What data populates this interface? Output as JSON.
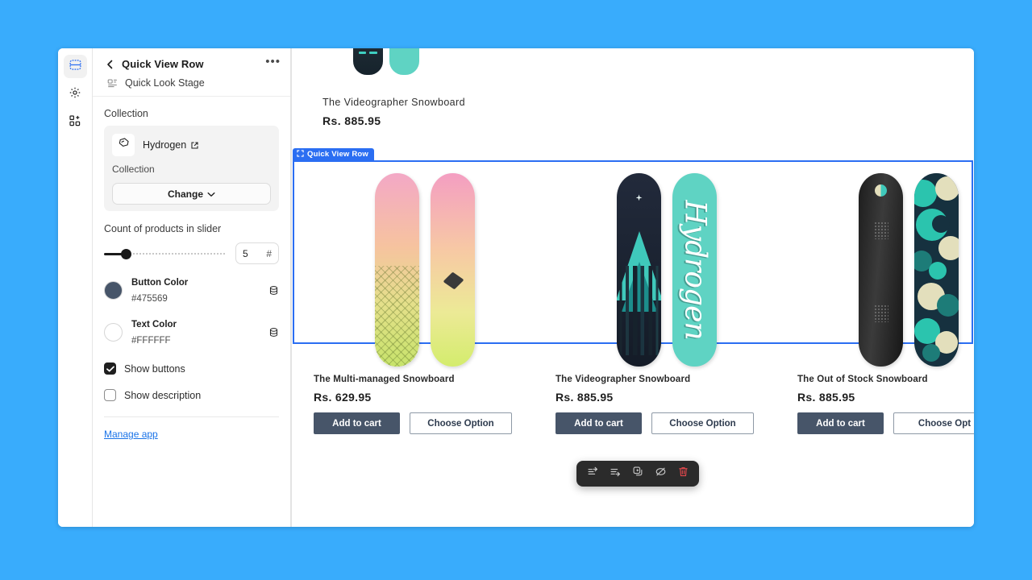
{
  "canvas": {
    "background": "#39ACFC"
  },
  "rail": {
    "items": [
      {
        "name": "sections-icon",
        "label": "Sections",
        "active": true
      },
      {
        "name": "settings-icon",
        "label": "Settings",
        "active": false
      },
      {
        "name": "apps-icon",
        "label": "Apps",
        "active": false
      }
    ]
  },
  "panel": {
    "back_icon": "chevron-left-icon",
    "title": "Quick View Row",
    "more_icon": "ellipsis-icon",
    "stage_icon": "stage-icon",
    "stage_label": "Quick Look Stage",
    "collection": {
      "section_label": "Collection",
      "thumb_icon": "collection-icon",
      "name": "Hydrogen",
      "external_icon": "external-link-icon",
      "type": "Collection",
      "change_label": "Change",
      "change_chevron": "chevron-down-icon"
    },
    "count": {
      "label": "Count of products in slider",
      "value": "5",
      "unit": "#",
      "fill_percent": 18
    },
    "colors": [
      {
        "name": "Button Color",
        "hex": "#475569",
        "swatch": "#475569",
        "source_icon": "data-source-icon"
      },
      {
        "name": "Text Color",
        "hex": "#FFFFFF",
        "swatch": "#FFFFFF",
        "source_icon": "data-source-icon"
      }
    ],
    "checkboxes": [
      {
        "label": "Show buttons",
        "checked": true
      },
      {
        "label": "Show description",
        "checked": false
      }
    ],
    "manage_link": "Manage app"
  },
  "preview": {
    "top_product": {
      "title": "The Videographer Snowboard",
      "price": "Rs. 885.95"
    },
    "selection": {
      "badge_icon": "frame-select-icon",
      "badge_label": "Quick View Row",
      "border_color": "#2b6ef2"
    },
    "products": [
      {
        "title": "The Multi-managed Snowboard",
        "price": "Rs. 629.95",
        "add_label": "Add to cart",
        "choose_label": "Choose Option"
      },
      {
        "title": "The Videographer Snowboard",
        "price": "Rs. 885.95",
        "add_label": "Add to cart",
        "choose_label": "Choose Option",
        "board_text": "Hydrogen"
      },
      {
        "title": "The Out of Stock Snowboard",
        "price": "Rs. 885.95",
        "add_label": "Add to cart",
        "choose_label": "Choose Opt"
      }
    ],
    "button_color": "#475569",
    "button_text_color": "#FFFFFF"
  },
  "toolbar": {
    "items": [
      {
        "name": "move-up-button",
        "icon": "move-up-icon"
      },
      {
        "name": "move-down-button",
        "icon": "move-down-icon"
      },
      {
        "name": "duplicate-button",
        "icon": "duplicate-icon"
      },
      {
        "name": "hide-button",
        "icon": "hide-icon"
      },
      {
        "name": "delete-button",
        "icon": "trash-icon"
      }
    ]
  }
}
